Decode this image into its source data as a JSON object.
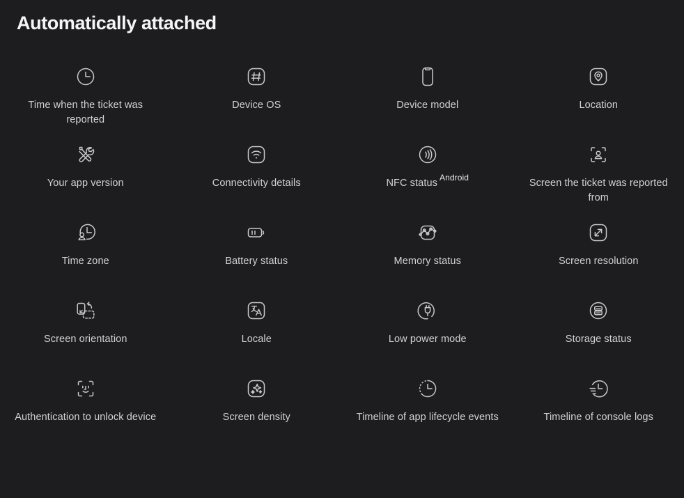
{
  "header": {
    "title": "Automatically attached"
  },
  "theme": {
    "background": "#1d1d1f",
    "title_color": "#f5f5f7",
    "label_color": "#d2d2d4",
    "icon_stroke": "#c9c9cb"
  },
  "grid": {
    "columns": 4,
    "rows": 5,
    "items": [
      {
        "label": "Time when the ticket was reported",
        "icon": "clock-icon",
        "badge": ""
      },
      {
        "label": "Device OS",
        "icon": "hash-square-icon",
        "badge": ""
      },
      {
        "label": "Device model",
        "icon": "phone-icon",
        "badge": ""
      },
      {
        "label": "Location",
        "icon": "map-pin-square-icon",
        "badge": ""
      },
      {
        "label": "Your app version",
        "icon": "tools-icon",
        "badge": ""
      },
      {
        "label": "Connectivity details",
        "icon": "wifi-square-icon",
        "badge": ""
      },
      {
        "label": "NFC status",
        "icon": "nfc-icon",
        "badge": "Android"
      },
      {
        "label": "Screen the ticket was reported from",
        "icon": "screen-person-icon",
        "badge": ""
      },
      {
        "label": "Time zone",
        "icon": "clock-person-icon",
        "badge": ""
      },
      {
        "label": "Battery status",
        "icon": "battery-icon",
        "badge": ""
      },
      {
        "label": "Memory status",
        "icon": "memory-chart-square-icon",
        "badge": ""
      },
      {
        "label": "Screen resolution",
        "icon": "expand-square-icon",
        "badge": ""
      },
      {
        "label": "Screen orientation",
        "icon": "screen-rotate-icon",
        "badge": ""
      },
      {
        "label": "Locale",
        "icon": "translate-square-icon",
        "badge": ""
      },
      {
        "label": "Low power mode",
        "icon": "power-plug-circle-icon",
        "badge": ""
      },
      {
        "label": "Storage status",
        "icon": "storage-circle-icon",
        "badge": ""
      },
      {
        "label": "Authentication to unlock device",
        "icon": "face-id-icon",
        "badge": ""
      },
      {
        "label": "Screen density",
        "icon": "sparkles-square-icon",
        "badge": ""
      },
      {
        "label": "Timeline of app lifecycle events",
        "icon": "clock-dotted-icon",
        "badge": ""
      },
      {
        "label": "Timeline of console logs",
        "icon": "clock-motion-icon",
        "badge": ""
      }
    ]
  }
}
